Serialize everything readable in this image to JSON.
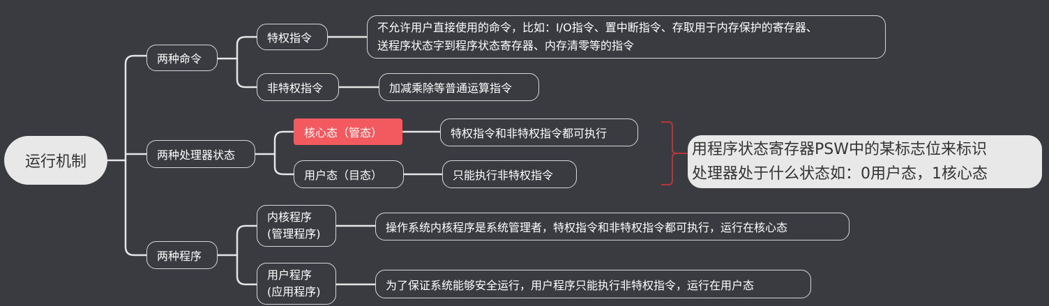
{
  "root": {
    "label": "运行机制"
  },
  "branches": {
    "commands": {
      "label": "两种命令",
      "privileged": {
        "label": "特权指令",
        "desc_line1": "不允许用户直接使用的命令，比如：I/O指令、置中断指令、存取用于内存保护的寄存器、",
        "desc_line2": "送程序状态字到程序状态寄存器、内存清零等的指令"
      },
      "non_privileged": {
        "label": "非特权指令",
        "desc": "加减乘除等普通运算指令"
      }
    },
    "states": {
      "label": "两种处理器状态",
      "kernel": {
        "label": "核心态（管态）",
        "desc": "特权指令和非特权指令都可执行"
      },
      "user": {
        "label": "用户态（目态）",
        "desc": "只能执行非特权指令"
      },
      "note_line1": "用程序状态寄存器PSW中的某标志位来标识",
      "note_line2": "处理器处于什么状态如：0用户态，1核心态"
    },
    "programs": {
      "label": "两种程序",
      "kernel_program": {
        "label_line1": "内核程序",
        "label_line2": "(管理程序)",
        "desc": "操作系统内核程序是系统管理者，特权指令和非特权指令都可执行，运行在核心态"
      },
      "user_program": {
        "label_line1": "用户程序",
        "label_line2": "(应用程序)",
        "desc": "为了保证系统能够安全运行，用户程序只能执行非特权指令，运行在用户态"
      }
    }
  },
  "colors": {
    "background": "#393b40",
    "line": "#e6e6e6",
    "highlight": "#f25a5f",
    "bracket": "#b8353a"
  }
}
